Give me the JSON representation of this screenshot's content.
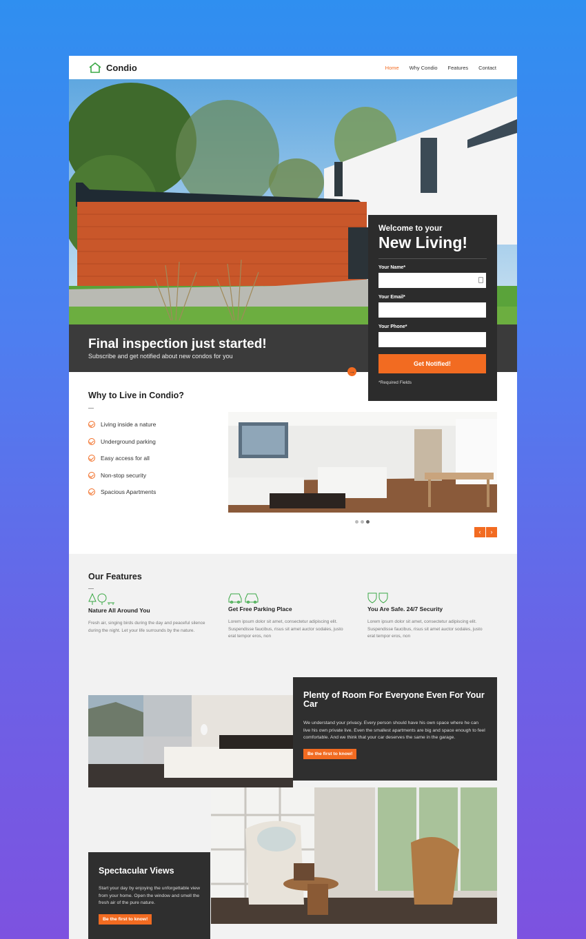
{
  "header": {
    "brand": "Condio",
    "nav": [
      "Home",
      "Why Condio",
      "Features",
      "Contact"
    ]
  },
  "hero": {
    "title": "Final inspection just started!",
    "subtitle": "Subscribe and get notified about new condos for you"
  },
  "signup": {
    "welcome": "Welcome to your",
    "headline": "New Living!",
    "name_label": "Your Name*",
    "email_label": "Your Email*",
    "phone_label": "Your Phone*",
    "button": "Get Notified!",
    "required_note": "*Required Fields"
  },
  "why": {
    "title": "Why to Live in Condio?",
    "items": [
      "Living inside a nature",
      "Underground parking",
      "Easy access for all",
      "Non-stop security",
      "Spacious Apartments"
    ],
    "prev": "‹",
    "next": "›"
  },
  "features": {
    "title": "Our Features",
    "items": [
      {
        "title": "Nature All Around You",
        "text": "Fresh air, singing birds during the day and peaceful silence during the night. Let your life surrounds by the nature."
      },
      {
        "title": "Get Free Parking Place",
        "text": "Lorem ipsum dolor sit amet, consectetur adipiscing elit. Suspendisse faucibus, risus sit amet auctor sodales, justo erat tempor eros, non"
      },
      {
        "title": "You Are Safe. 24/7 Security",
        "text": "Lorem ipsum dolor sit amet, consectetur adipiscing elit. Suspendisse faucibus, risus sit amet auctor sodales, justo erat tempor eros, non"
      }
    ]
  },
  "room": {
    "title": "Plenty of Room For Everyone Even For Your Car",
    "text": "We understand your privacy. Every person should have his own space where he can live his own private live. Even the smallest apartments are big and space enough to feel comfortable. And we think that your car deserves the same in the garage.",
    "button": "Be the first to know!"
  },
  "views": {
    "title": "Spectacular Views",
    "text": "Start your day by enjoying the unforgettable view from your home. Open the window and smell the fresh air of the pure nature.",
    "button": "Be the first to know!"
  },
  "colors": {
    "accent": "#f26b21",
    "dark": "#2f2f2f",
    "brand_green": "#3aa845"
  }
}
